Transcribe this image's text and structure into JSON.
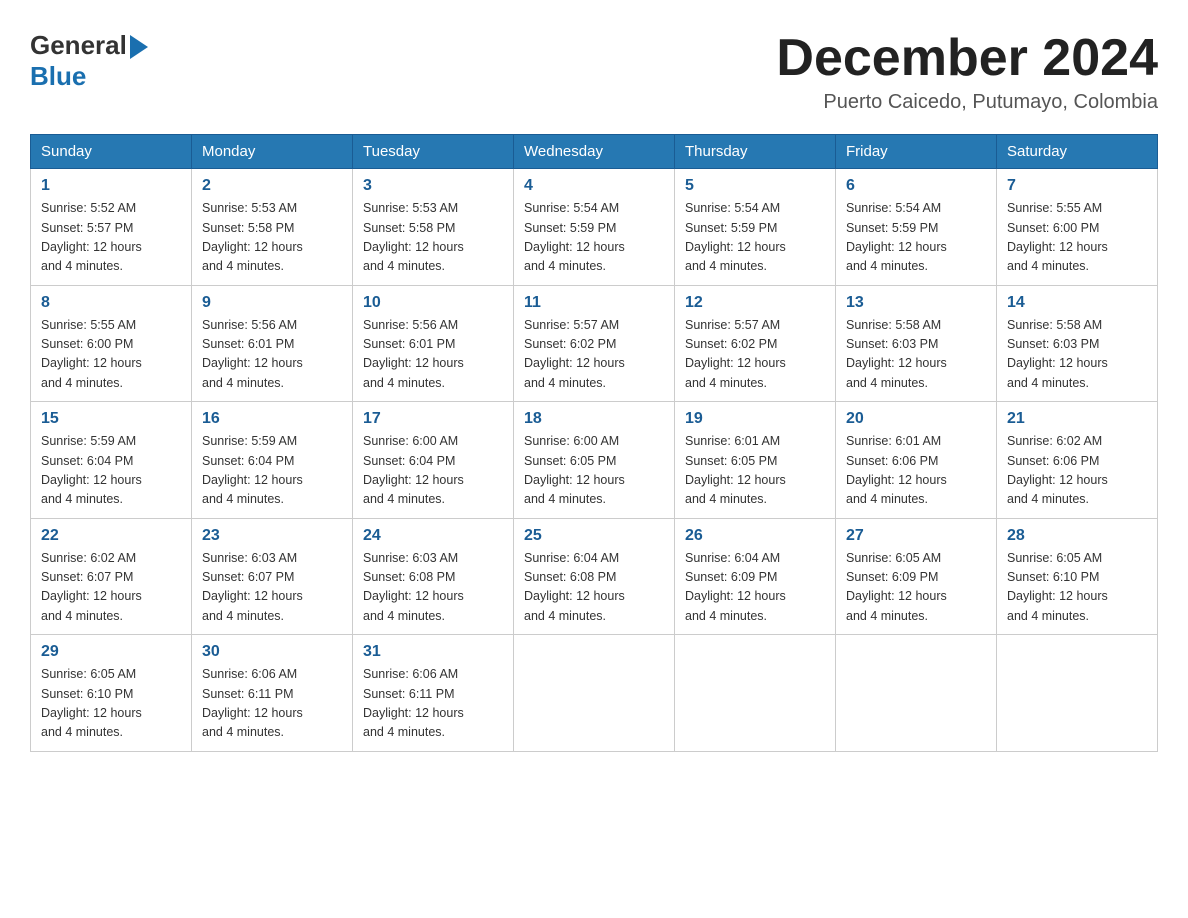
{
  "header": {
    "logo_general": "General",
    "logo_blue": "Blue",
    "month_title": "December 2024",
    "location": "Puerto Caicedo, Putumayo, Colombia"
  },
  "weekdays": [
    "Sunday",
    "Monday",
    "Tuesday",
    "Wednesday",
    "Thursday",
    "Friday",
    "Saturday"
  ],
  "weeks": [
    [
      {
        "day": "1",
        "sunrise": "5:52 AM",
        "sunset": "5:57 PM",
        "daylight": "12 hours and 4 minutes."
      },
      {
        "day": "2",
        "sunrise": "5:53 AM",
        "sunset": "5:58 PM",
        "daylight": "12 hours and 4 minutes."
      },
      {
        "day": "3",
        "sunrise": "5:53 AM",
        "sunset": "5:58 PM",
        "daylight": "12 hours and 4 minutes."
      },
      {
        "day": "4",
        "sunrise": "5:54 AM",
        "sunset": "5:59 PM",
        "daylight": "12 hours and 4 minutes."
      },
      {
        "day": "5",
        "sunrise": "5:54 AM",
        "sunset": "5:59 PM",
        "daylight": "12 hours and 4 minutes."
      },
      {
        "day": "6",
        "sunrise": "5:54 AM",
        "sunset": "5:59 PM",
        "daylight": "12 hours and 4 minutes."
      },
      {
        "day": "7",
        "sunrise": "5:55 AM",
        "sunset": "6:00 PM",
        "daylight": "12 hours and 4 minutes."
      }
    ],
    [
      {
        "day": "8",
        "sunrise": "5:55 AM",
        "sunset": "6:00 PM",
        "daylight": "12 hours and 4 minutes."
      },
      {
        "day": "9",
        "sunrise": "5:56 AM",
        "sunset": "6:01 PM",
        "daylight": "12 hours and 4 minutes."
      },
      {
        "day": "10",
        "sunrise": "5:56 AM",
        "sunset": "6:01 PM",
        "daylight": "12 hours and 4 minutes."
      },
      {
        "day": "11",
        "sunrise": "5:57 AM",
        "sunset": "6:02 PM",
        "daylight": "12 hours and 4 minutes."
      },
      {
        "day": "12",
        "sunrise": "5:57 AM",
        "sunset": "6:02 PM",
        "daylight": "12 hours and 4 minutes."
      },
      {
        "day": "13",
        "sunrise": "5:58 AM",
        "sunset": "6:03 PM",
        "daylight": "12 hours and 4 minutes."
      },
      {
        "day": "14",
        "sunrise": "5:58 AM",
        "sunset": "6:03 PM",
        "daylight": "12 hours and 4 minutes."
      }
    ],
    [
      {
        "day": "15",
        "sunrise": "5:59 AM",
        "sunset": "6:04 PM",
        "daylight": "12 hours and 4 minutes."
      },
      {
        "day": "16",
        "sunrise": "5:59 AM",
        "sunset": "6:04 PM",
        "daylight": "12 hours and 4 minutes."
      },
      {
        "day": "17",
        "sunrise": "6:00 AM",
        "sunset": "6:04 PM",
        "daylight": "12 hours and 4 minutes."
      },
      {
        "day": "18",
        "sunrise": "6:00 AM",
        "sunset": "6:05 PM",
        "daylight": "12 hours and 4 minutes."
      },
      {
        "day": "19",
        "sunrise": "6:01 AM",
        "sunset": "6:05 PM",
        "daylight": "12 hours and 4 minutes."
      },
      {
        "day": "20",
        "sunrise": "6:01 AM",
        "sunset": "6:06 PM",
        "daylight": "12 hours and 4 minutes."
      },
      {
        "day": "21",
        "sunrise": "6:02 AM",
        "sunset": "6:06 PM",
        "daylight": "12 hours and 4 minutes."
      }
    ],
    [
      {
        "day": "22",
        "sunrise": "6:02 AM",
        "sunset": "6:07 PM",
        "daylight": "12 hours and 4 minutes."
      },
      {
        "day": "23",
        "sunrise": "6:03 AM",
        "sunset": "6:07 PM",
        "daylight": "12 hours and 4 minutes."
      },
      {
        "day": "24",
        "sunrise": "6:03 AM",
        "sunset": "6:08 PM",
        "daylight": "12 hours and 4 minutes."
      },
      {
        "day": "25",
        "sunrise": "6:04 AM",
        "sunset": "6:08 PM",
        "daylight": "12 hours and 4 minutes."
      },
      {
        "day": "26",
        "sunrise": "6:04 AM",
        "sunset": "6:09 PM",
        "daylight": "12 hours and 4 minutes."
      },
      {
        "day": "27",
        "sunrise": "6:05 AM",
        "sunset": "6:09 PM",
        "daylight": "12 hours and 4 minutes."
      },
      {
        "day": "28",
        "sunrise": "6:05 AM",
        "sunset": "6:10 PM",
        "daylight": "12 hours and 4 minutes."
      }
    ],
    [
      {
        "day": "29",
        "sunrise": "6:05 AM",
        "sunset": "6:10 PM",
        "daylight": "12 hours and 4 minutes."
      },
      {
        "day": "30",
        "sunrise": "6:06 AM",
        "sunset": "6:11 PM",
        "daylight": "12 hours and 4 minutes."
      },
      {
        "day": "31",
        "sunrise": "6:06 AM",
        "sunset": "6:11 PM",
        "daylight": "12 hours and 4 minutes."
      },
      null,
      null,
      null,
      null
    ]
  ],
  "labels": {
    "sunrise": "Sunrise:",
    "sunset": "Sunset:",
    "daylight": "Daylight: 12 hours"
  }
}
